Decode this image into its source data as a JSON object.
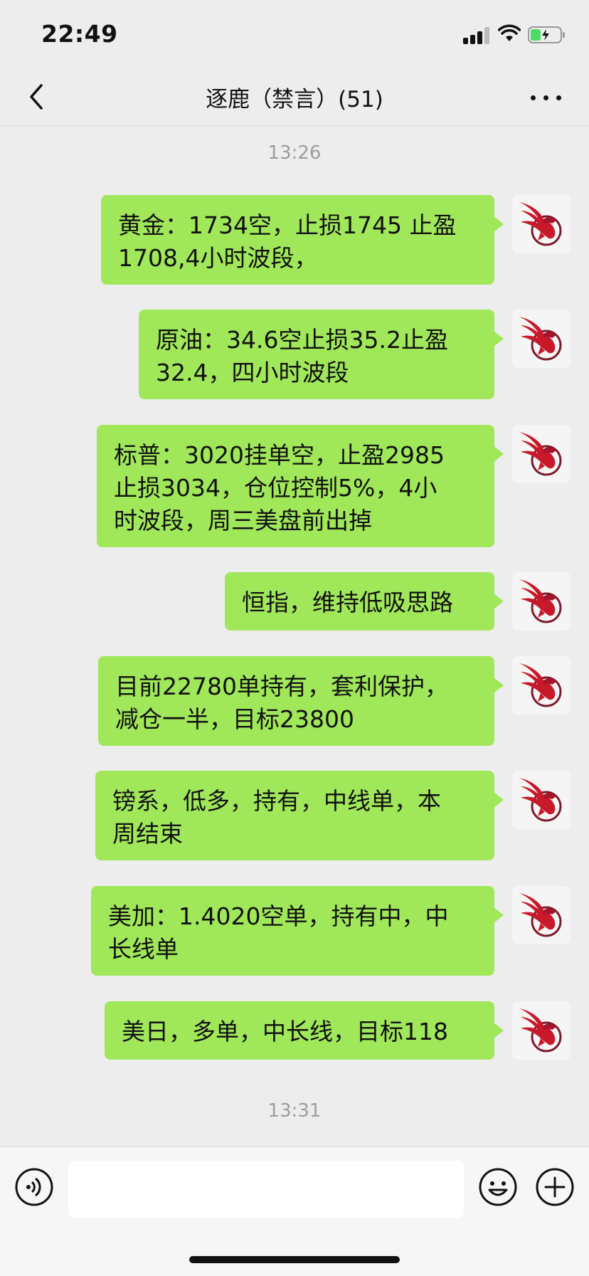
{
  "status_bar": {
    "time": "22:49"
  },
  "header": {
    "title": "逐鹿（禁言）(51)"
  },
  "chat": {
    "timestamps": [
      "13:26",
      "13:31"
    ],
    "messages": [
      {
        "text": "黄金：1734空，止损1745 止盈\n1708,4小时波段，"
      },
      {
        "text": "原油：34.6空止损35.2止盈\n32.4，四小时波段"
      },
      {
        "text": "标普：3020挂单空，止盈2985\n止损3034，仓位控制5%，4小\n时波段，周三美盘前出掉"
      },
      {
        "text": "恒指，维持低吸思路"
      },
      {
        "text": "目前22780单持有，套利保护，\n减仓一半，目标23800"
      },
      {
        "text": "镑系，低多，持有，中线单，本\n周结束"
      },
      {
        "text": "美加：1.4020空单，持有中，中\n长线单"
      },
      {
        "text": "美日，多单，中长线，目标118"
      }
    ]
  },
  "input_bar": {
    "value": "",
    "placeholder": ""
  },
  "colors": {
    "bubble": "#a0e75a",
    "background": "#ededed",
    "avatar_bird": "#c8192a"
  },
  "icons": {
    "back": "chevron-left-icon",
    "more": "more-dots-icon",
    "voice": "voice-icon",
    "emoji": "emoji-icon",
    "add": "plus-icon"
  }
}
